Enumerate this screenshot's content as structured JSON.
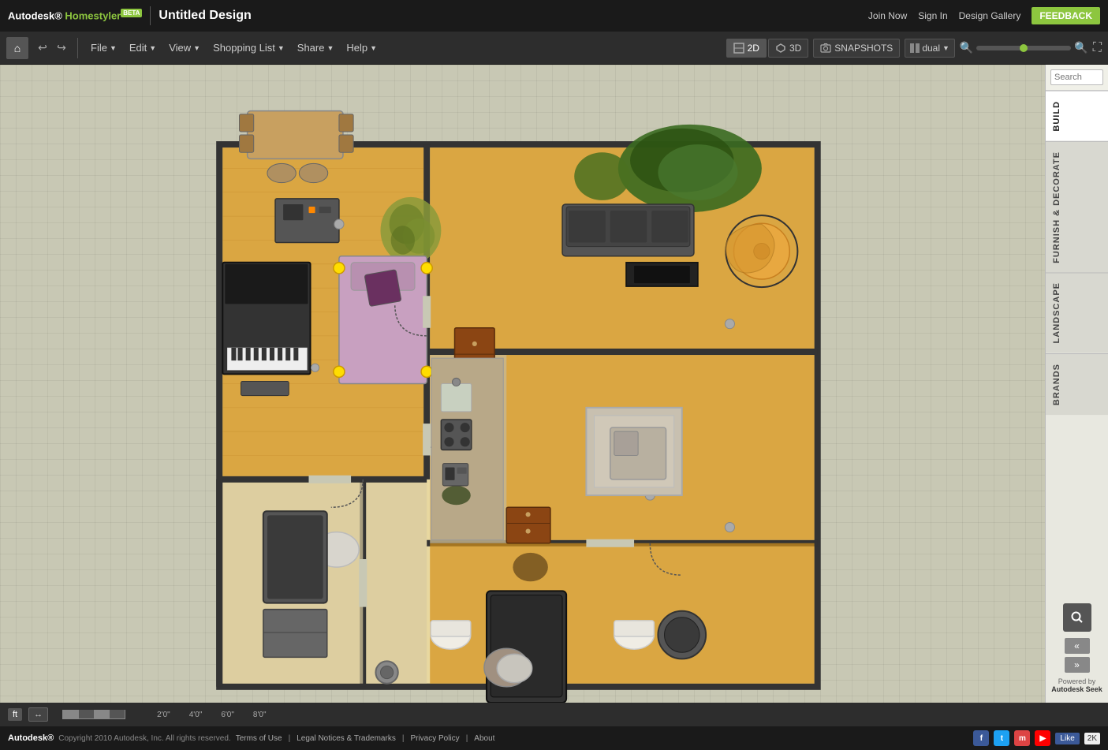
{
  "app": {
    "name": "Autodesk",
    "product": "Homestyler",
    "beta": "BETA",
    "title": "Untitled Design"
  },
  "topbar": {
    "join_now": "Join Now",
    "sign_in": "Sign In",
    "design_gallery": "Design Gallery",
    "feedback": "FEEDBACK"
  },
  "toolbar": {
    "file": "File",
    "edit": "Edit",
    "view": "View",
    "shopping_list": "Shopping List",
    "share": "Share",
    "help": "Help",
    "view_2d": "2D",
    "view_3d": "3D",
    "snapshots": "SNAPSHOTS",
    "dual": "dual"
  },
  "right_panel": {
    "search_placeholder": "Search",
    "tabs": [
      "BUILD",
      "FURNISH & DECORATE",
      "LANDSCAPE",
      "BRANDS"
    ]
  },
  "statusbar": {
    "unit": "ft",
    "ruler_icon": "↔",
    "scale": [
      "2'0\"",
      "4'0\"",
      "6'0\"",
      "8'0\""
    ]
  },
  "footer": {
    "autodesk": "Autodesk®",
    "copyright": "Copyright 2010 Autodesk, Inc. All rights reserved.",
    "terms": "Terms of Use",
    "legal": "Legal Notices & Trademarks",
    "privacy": "Privacy Policy",
    "about": "About",
    "like": "Like",
    "like_count": "2K"
  },
  "powered_by": "Powered by Autodesk Seek"
}
